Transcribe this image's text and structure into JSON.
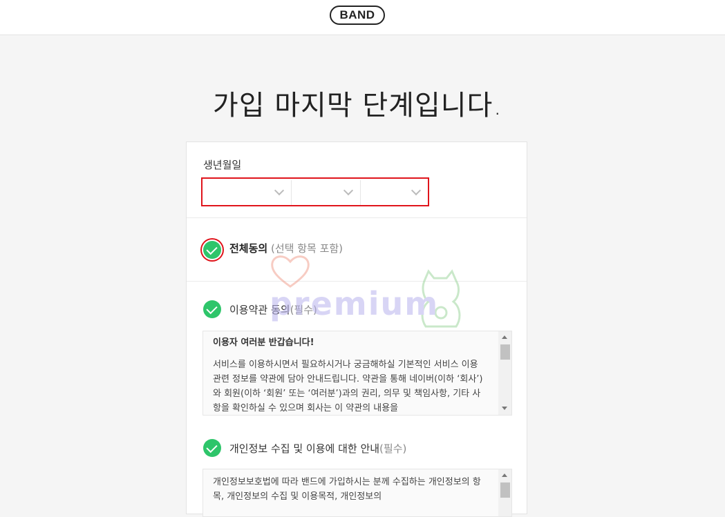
{
  "header": {
    "logo": "BAND"
  },
  "main": {
    "title": "가입 마지막 단계입니다.",
    "birth": {
      "label": "생년월일",
      "year": "",
      "month": "",
      "day": ""
    },
    "agree_all": {
      "label": "전체동의",
      "note": "(선택 항목 포함)",
      "checked": true
    },
    "terms": [
      {
        "label": "이용약관 동의",
        "required": "(필수)",
        "checked": true,
        "heading": "이용자 여러분 반갑습니다!",
        "body": "서비스를 이용하시면서 필요하시거나 궁금해하실 기본적인 서비스 이용 관련 정보를 약관에 담아 안내드립니다. 약관을 통해 네이버(이하 ‘회사’)와 회원(이하 ‘회원’ 또는 ‘여러분’)과의 권리, 의무 및 책임사항, 기타 사항을 확인하실 수 있으며 회사는 이 약관의 내용을"
      },
      {
        "label": "개인정보 수집 및 이용에 대한 안내",
        "required": "(필수)",
        "checked": true,
        "heading": "",
        "body": "개인정보보호법에 따라 밴드에 가입하시는 분께 수집하는 개인정보의 항목, 개인정보의 수집 및 이용목적, 개인정보의"
      }
    ]
  },
  "watermark": {
    "text": "premium"
  },
  "colors": {
    "accent_green": "#2ec56a",
    "highlight_red": "#e0141b"
  }
}
